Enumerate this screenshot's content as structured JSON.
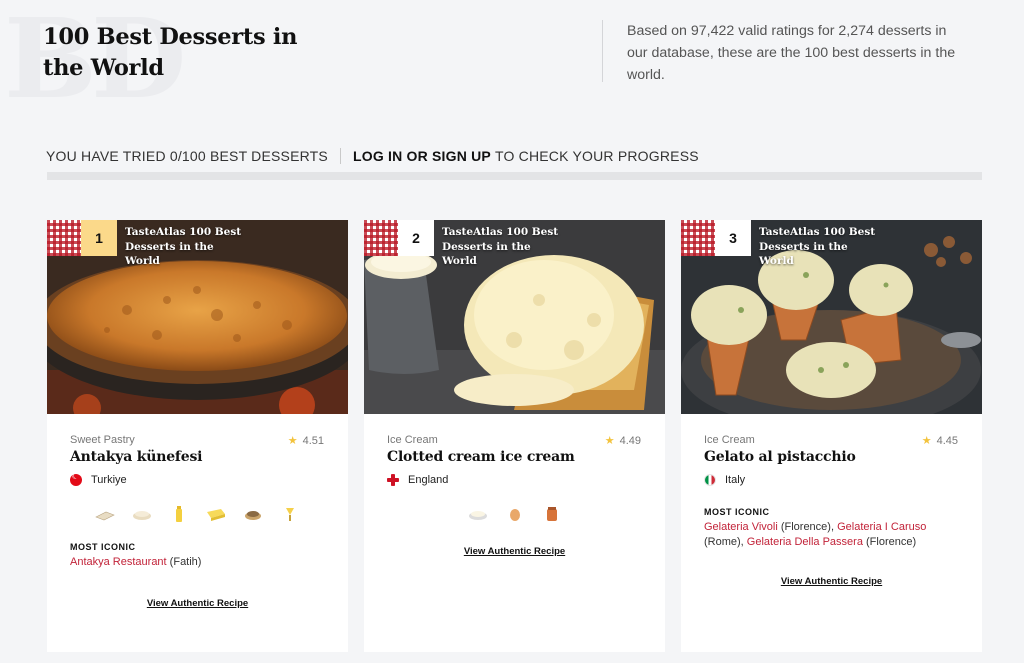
{
  "watermark": "BD",
  "header": {
    "title": "100 Best Desserts in the World",
    "summary": "Based on 97,422 valid ratings for 2,274 desserts in our database, these are the 100 best desserts in the world."
  },
  "progress": {
    "tried_text": "YOU HAVE TRIED 0/100 BEST DESSERTS",
    "login_label": "LOG IN OR SIGN UP",
    "rest_text": "TO CHECK YOUR PROGRESS",
    "tried_fraction": 0
  },
  "ribbon_text": "TasteAtlas 100 Best Desserts in the World",
  "recipe_label": "View Authentic Recipe",
  "iconic_title": "MOST ICONIC",
  "colors": {
    "rank_highlight": "#fbd98a",
    "place_link": "#c22339",
    "star": "#f3c33d"
  },
  "cards": [
    {
      "rank": "1",
      "category": "Sweet Pastry",
      "rating": "4.51",
      "name": "Antakya künefesi",
      "country": "Turkiye",
      "flag": "turkey-flag-icon",
      "ingredients": [
        "dough-icon",
        "cheese-icon",
        "butter-icon",
        "cheese-block-icon",
        "pastry-icon",
        "syrup-icon"
      ],
      "iconic": [
        {
          "place": "Antakya Restaurant",
          "location": " (Fatih)"
        }
      ]
    },
    {
      "rank": "2",
      "category": "Ice Cream",
      "rating": "4.49",
      "name": "Clotted cream ice cream",
      "country": "England",
      "flag": "england-flag-icon",
      "ingredients": [
        "cream-icon",
        "egg-icon",
        "sugar-jar-icon"
      ],
      "iconic": []
    },
    {
      "rank": "3",
      "category": "Ice Cream",
      "rating": "4.45",
      "name": "Gelato al pistacchio",
      "country": "Italy",
      "flag": "italy-flag-icon",
      "ingredients": [],
      "iconic": [
        {
          "place": "Gelateria Vivoli",
          "location": " (Florence), "
        },
        {
          "place": "Gelateria I Caruso",
          "location": " (Rome), "
        },
        {
          "place": "Gelateria Della Passera",
          "location": " (Florence)"
        }
      ]
    }
  ]
}
